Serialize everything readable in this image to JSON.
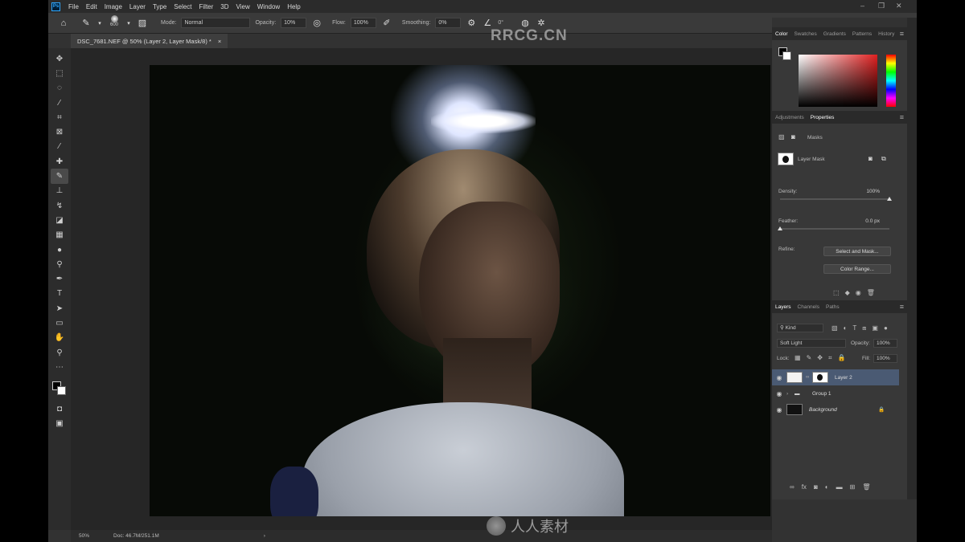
{
  "menubar": {
    "logo": "Ps",
    "items": [
      "File",
      "Edit",
      "Image",
      "Layer",
      "Type",
      "Select",
      "Filter",
      "3D",
      "View",
      "Window",
      "Help"
    ]
  },
  "options": {
    "brush_size": "600",
    "mode_label": "Mode:",
    "mode_value": "Normal",
    "opacity_label": "Opacity:",
    "opacity_value": "10%",
    "flow_label": "Flow:",
    "flow_value": "100%",
    "smoothing_label": "Smoothing:",
    "smoothing_value": "0%",
    "angle_value": "0°"
  },
  "watermark_top": "RRCG.CN",
  "watermark_bottom": "人人素材",
  "document": {
    "tab_title": "DSC_7681.NEF @ 50% (Layer 2, Layer Mask/8) *",
    "close": "×"
  },
  "status": {
    "zoom": "50%",
    "doc_size": "Doc: 46.7M/251.1M",
    "arrow": "›"
  },
  "color_panel": {
    "tabs": [
      "Color",
      "Swatches",
      "Gradients",
      "Patterns",
      "History"
    ]
  },
  "properties_panel": {
    "tabs": [
      "Adjustments",
      "Properties"
    ],
    "masks_label": "Masks",
    "layer_mask_label": "Layer Mask",
    "density_label": "Density:",
    "density_value": "100%",
    "density_level": 1.0,
    "feather_label": "Feather:",
    "feather_value": "0.0 px",
    "feather_level": 0.0,
    "refine_label": "Refine:",
    "select_mask_button": "Select and Mask...",
    "color_range_button": "Color Range..."
  },
  "layers_panel": {
    "tabs": [
      "Layers",
      "Channels",
      "Paths"
    ],
    "filter_kind": "Kind",
    "blend_mode": "Soft Light",
    "opacity_label": "Opacity:",
    "opacity_value": "100%",
    "lock_label": "Lock:",
    "fill_label": "Fill:",
    "fill_value": "100%",
    "layers": [
      {
        "name": "Layer 2",
        "selected": true
      },
      {
        "name": "Group 1",
        "selected": false
      },
      {
        "name": "Background",
        "selected": false
      }
    ]
  }
}
